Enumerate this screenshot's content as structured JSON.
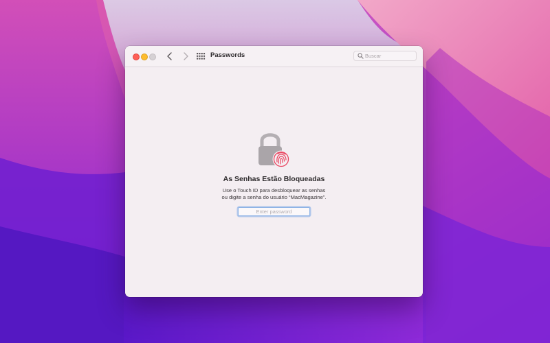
{
  "window": {
    "title": "Passwords",
    "search_placeholder": "Buscar"
  },
  "locked_view": {
    "heading": "As Senhas Estão Bloqueadas",
    "description_line1": "Use o Touch ID para desbloquear as senhas",
    "description_line2": "ou digite a senha do usuário “MacMagazine”.",
    "password_placeholder": "Enter password"
  },
  "icons": {
    "lock": "lock-icon",
    "fingerprint": "touch-id-fingerprint-icon",
    "back": "chevron-left-icon",
    "forward": "chevron-right-icon",
    "grid": "grid-icon",
    "search": "magnifying-glass-icon"
  },
  "colors": {
    "traffic_close": "#fe5f57",
    "traffic_minimize": "#febc2e",
    "traffic_zoom_inactive": "#d6d1d4",
    "fingerprint": "#e9445f",
    "field_focus": "#8fb4e6"
  }
}
